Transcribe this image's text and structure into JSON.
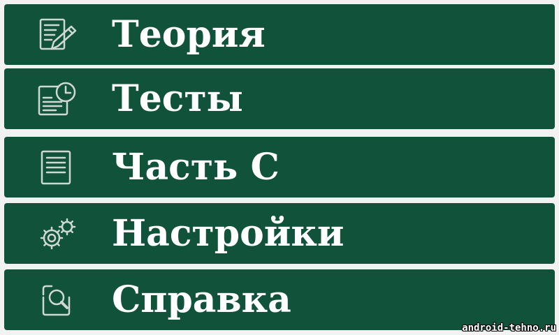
{
  "menu": {
    "items": [
      {
        "label": "Теория",
        "icon": "edit-document-icon"
      },
      {
        "label": "Тесты",
        "icon": "document-clock-icon"
      },
      {
        "label": "Часть С",
        "icon": "document-icon"
      },
      {
        "label": "Настройки",
        "icon": "gears-icon"
      },
      {
        "label": "Справка",
        "icon": "search-icon"
      }
    ]
  },
  "watermark": "android-tehno.ru",
  "colors": {
    "item_background": "#11523a",
    "text": "#ffffff",
    "separator": "#f2f2f2"
  }
}
